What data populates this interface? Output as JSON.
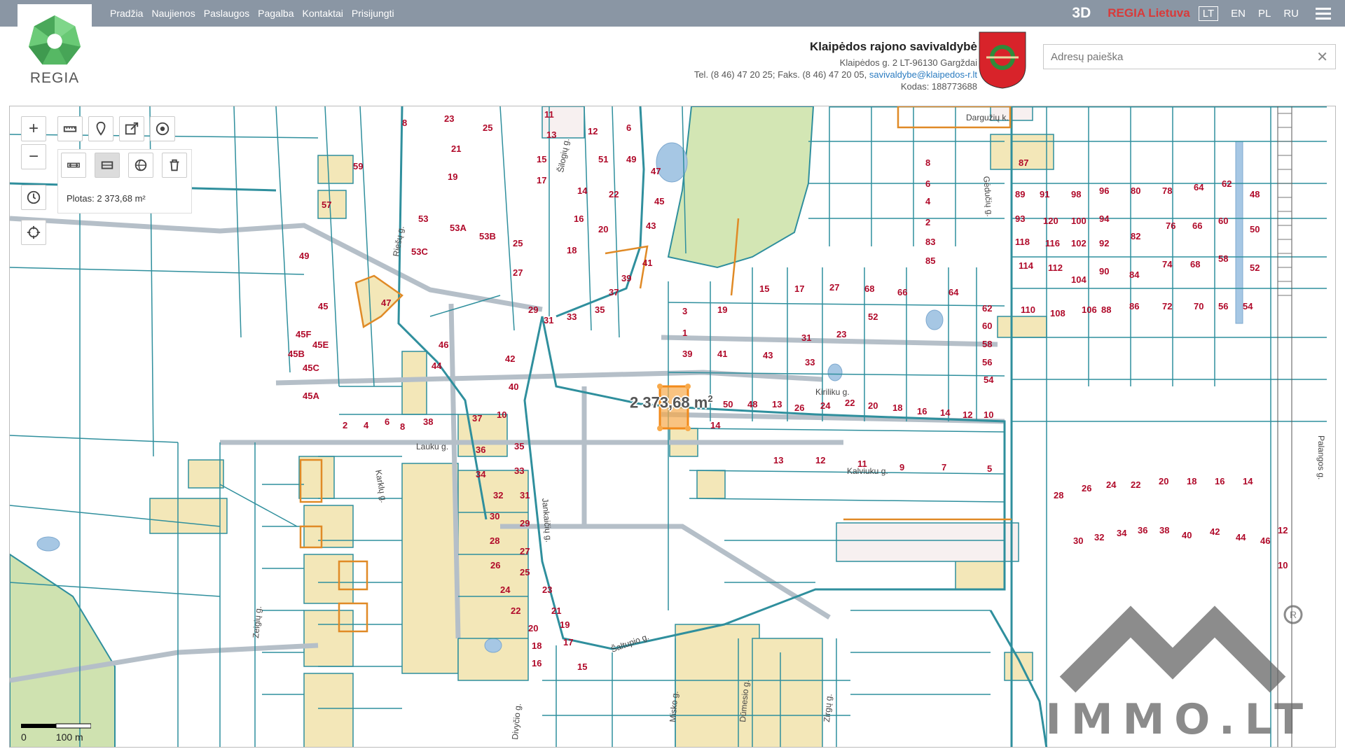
{
  "nav": {
    "links": [
      "Pradžia",
      "Naujienos",
      "Paslaugos",
      "Pagalba",
      "Kontaktai",
      "Prisijungti"
    ],
    "btn_3d": "3D",
    "regia_lietuva": "REGIA Lietuva",
    "languages": [
      "LT",
      "EN",
      "PL",
      "RU"
    ],
    "active_language": "LT"
  },
  "logo": {
    "text": "REGIA"
  },
  "header": {
    "title": "Klaipėdos rajono savivaldybė",
    "address": "Klaipėdos g. 2 LT-96130 Gargždai",
    "phone": "Tel. (8 46) 47 20 25; Faks. (8 46) 47 20 05,",
    "email": "savivaldybe@klaipedos-r.lt",
    "code": "Kodas: 188773688"
  },
  "search": {
    "placeholder": "Adresų paieška",
    "value": ""
  },
  "tools": {
    "zoom_in": "+",
    "zoom_out": "−"
  },
  "measure": {
    "area_text": "Plotas: 2 373,68 m²",
    "label_value": "2 373,68 m",
    "label_unit": "2"
  },
  "scale": {
    "zero": "0",
    "distance": "100 m"
  },
  "watermark": {
    "text": "IMMO.LT"
  },
  "streets": [
    "Lauku g.",
    "Karklų g.",
    "Jankaičių g.",
    "Kiriliku g.",
    "Kalviuku g.",
    "Šaltupio g.",
    "Zeigių g.",
    "Riešų g.",
    "Šilogių g.",
    "Dargužių k.",
    "Gėdučių g.",
    "Palangos g.",
    "Misko g.",
    "Dūmesio g.",
    "Zirgų g.",
    "Divyčio g."
  ],
  "parcel_numbers": [
    "8",
    "23",
    "25",
    "11",
    "13",
    "12",
    "6",
    "15",
    "21",
    "51",
    "49",
    "17",
    "19",
    "59",
    "14",
    "22",
    "47",
    "45",
    "57",
    "53",
    "53A",
    "53B",
    "16",
    "20",
    "43",
    "49",
    "53C",
    "18",
    "41",
    "25",
    "27",
    "29",
    "31",
    "33",
    "35",
    "37",
    "39",
    "47",
    "45",
    "45F",
    "45E",
    "45B",
    "45C",
    "45A",
    "46",
    "44",
    "42",
    "40",
    "38",
    "2",
    "4",
    "6",
    "8",
    "37",
    "10",
    "36",
    "35",
    "34",
    "33",
    "32",
    "31",
    "30",
    "29",
    "28",
    "27",
    "26",
    "25",
    "24",
    "23",
    "22",
    "21",
    "20",
    "19",
    "18",
    "17",
    "16",
    "15",
    "14",
    "13",
    "12",
    "11",
    "9",
    "7",
    "5",
    "3",
    "1",
    "39",
    "41",
    "43",
    "33",
    "31",
    "23",
    "19",
    "15",
    "17",
    "27",
    "68",
    "66",
    "64",
    "62",
    "60",
    "58",
    "56",
    "54",
    "52",
    "50",
    "48",
    "13",
    "26",
    "24",
    "22",
    "20",
    "18",
    "16",
    "14",
    "12",
    "10",
    "8",
    "6",
    "4",
    "2",
    "83",
    "85",
    "87",
    "89",
    "91",
    "93",
    "120",
    "118",
    "116",
    "114",
    "112",
    "110",
    "108",
    "106",
    "104",
    "102",
    "100",
    "98",
    "96",
    "94",
    "92",
    "90",
    "88",
    "86",
    "84",
    "82",
    "80",
    "78",
    "76",
    "74",
    "72",
    "70",
    "68",
    "66",
    "64",
    "62",
    "60",
    "58",
    "56",
    "54",
    "52",
    "50",
    "48",
    "46",
    "44",
    "42",
    "40",
    "38",
    "36",
    "34",
    "32",
    "30",
    "28",
    "26",
    "24",
    "22",
    "20",
    "18",
    "16",
    "14",
    "12",
    "10",
    "8",
    "6",
    "4"
  ]
}
